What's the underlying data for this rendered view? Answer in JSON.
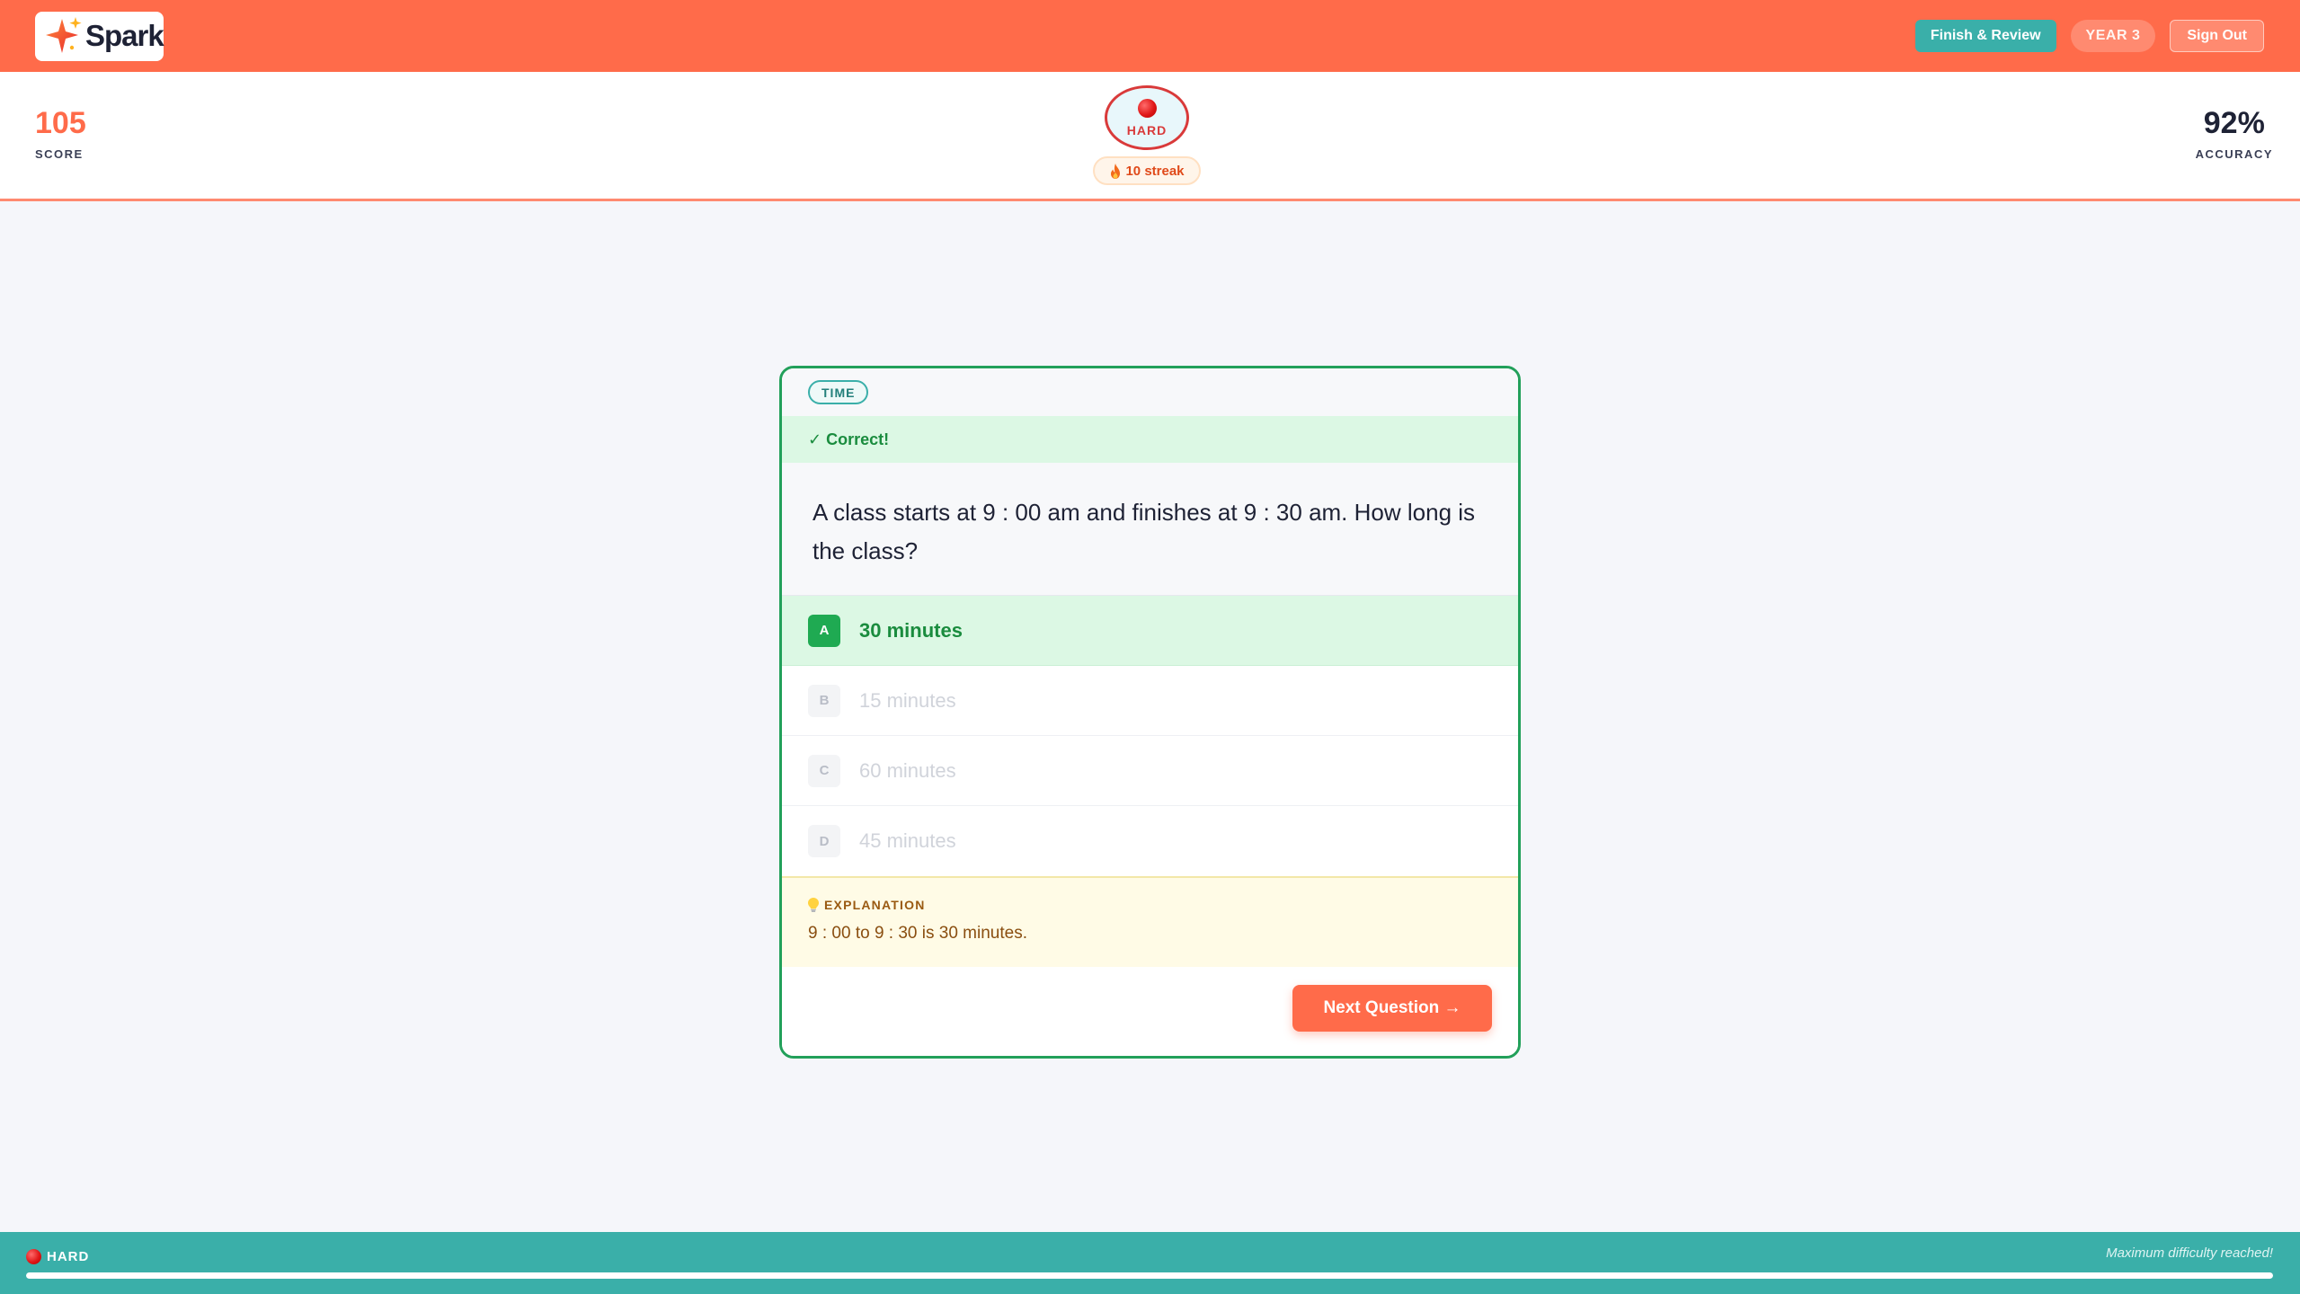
{
  "header": {
    "logo_text": "Spark",
    "finish_label": "Finish & Review",
    "year_label": "YEAR 3",
    "signout_label": "Sign Out",
    "colors": {
      "brand": "#ff6b4a",
      "accent": "#3aafa9"
    }
  },
  "stats": {
    "score_value": "105",
    "score_label": "SCORE",
    "accuracy_value": "92%",
    "accuracy_label": "ACCURACY",
    "difficulty_label": "HARD",
    "difficulty_icon": "red-circle-icon",
    "streak_label": "10 streak",
    "streak_icon": "fire-icon"
  },
  "question_card": {
    "topic": "TIME",
    "feedback": "✓ Correct!",
    "question_text": "A class starts at 9 : 00 am and finishes at 9 : 30 am. How long is the class?",
    "options": [
      {
        "letter": "A",
        "text": "30 minutes",
        "state": "correct"
      },
      {
        "letter": "B",
        "text": "15 minutes",
        "state": "disabled"
      },
      {
        "letter": "C",
        "text": "60 minutes",
        "state": "disabled"
      },
      {
        "letter": "D",
        "text": "45 minutes",
        "state": "disabled"
      }
    ],
    "explanation_heading": "EXPLANATION",
    "explanation_icon": "lightbulb-icon",
    "explanation_text": "9 : 00 to 9 : 30 is 30 minutes.",
    "next_label": "Next Question →"
  },
  "footer": {
    "level_label": "HARD",
    "note": "Maximum difficulty reached!",
    "progress": 1.0
  }
}
